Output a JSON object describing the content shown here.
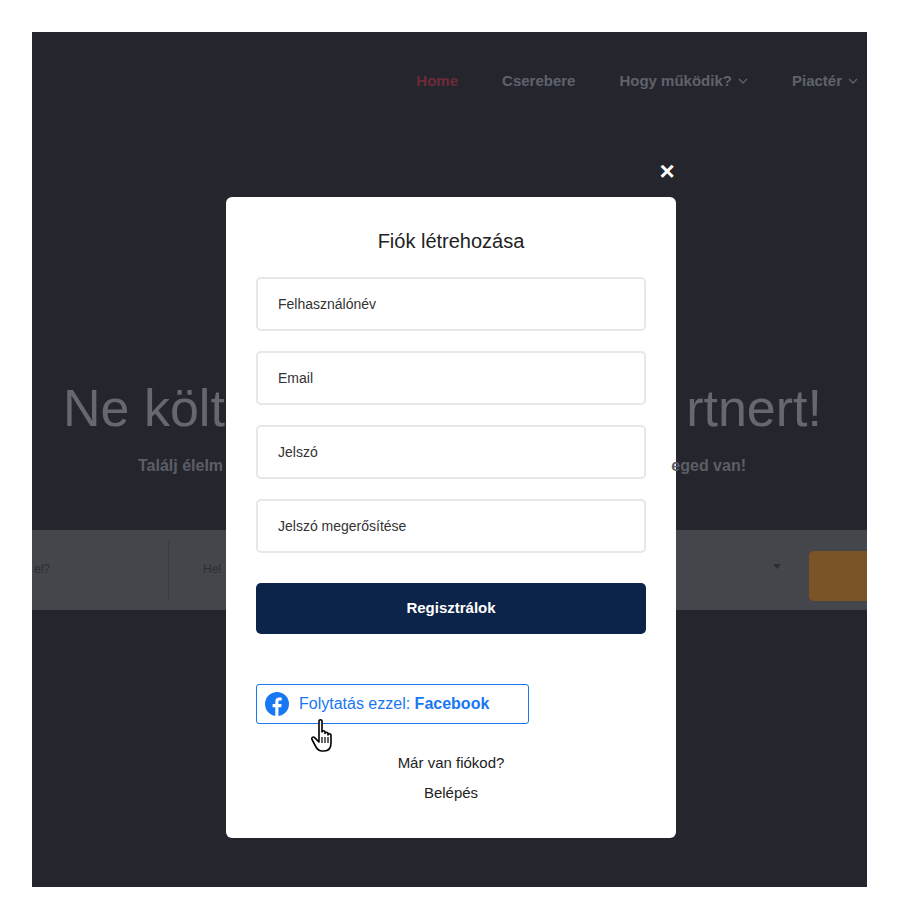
{
  "nav": [
    {
      "label": "Home",
      "selected": true,
      "has_menu": false
    },
    {
      "label": "Cserebere",
      "selected": false,
      "has_menu": false
    },
    {
      "label": "Hogy működik?",
      "selected": false,
      "has_menu": true
    },
    {
      "label": "Piactér",
      "selected": false,
      "has_menu": true
    }
  ],
  "hero": {
    "title_left": "Ne költ",
    "title_right": "rtnert!",
    "subtitle_left": "Találj élelm",
    "subtitle_right": "eged van!"
  },
  "search": {
    "field_what": "el?",
    "field_where": "Hel"
  },
  "modal": {
    "close": "×",
    "title": "Fiók létrehozása",
    "fields": [
      {
        "placeholder": "Felhasználónév"
      },
      {
        "placeholder": "Email"
      },
      {
        "placeholder": "Jelszó"
      },
      {
        "placeholder": "Jelszó megerősítése"
      }
    ],
    "submit": "Regisztrálok",
    "facebook": {
      "prefix": "Folytatás ezzel:",
      "brand": "Facebook"
    },
    "login_prompt": "Már van fiókod?",
    "login_link": "Belépés"
  }
}
